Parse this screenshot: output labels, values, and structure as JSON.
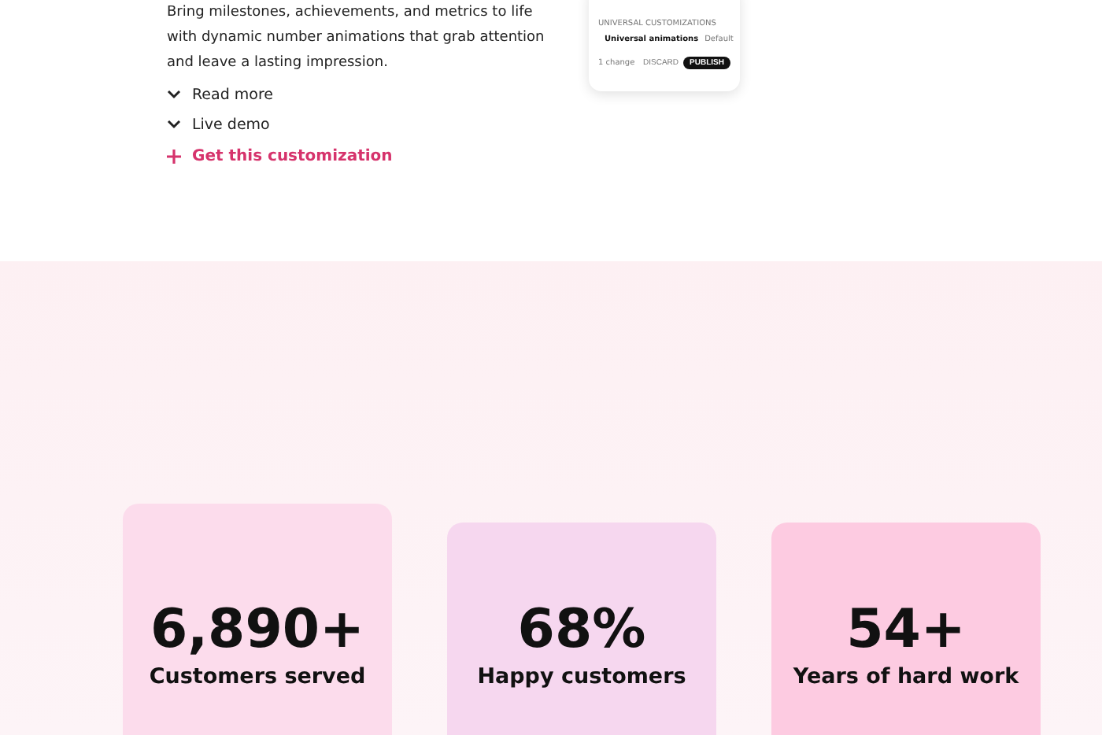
{
  "intro": {
    "description": "Bring milestones, achievements, and metrics to life with dynamic number animations that grab attention and leave a lasting impression.",
    "toggles": [
      {
        "label": "Read more",
        "expanded": false
      },
      {
        "label": "Live demo",
        "expanded": false
      }
    ],
    "cta": "Get this customization"
  },
  "preview": {
    "section_title": "UNIVERSAL CUSTOMIZATIONS",
    "setting": "Universal animations",
    "value": "Default",
    "changes": "1 change",
    "discard": "DISCARD",
    "publish": "PUBLISH"
  },
  "stats": [
    {
      "number": "6,890+",
      "label": "Customers served",
      "color": "#fcdcec"
    },
    {
      "number": "68%",
      "label": "Happy customers",
      "color": "#f6d7ef"
    },
    {
      "number": "54+",
      "label": "Years of hard work",
      "color": "#fdcbe1"
    }
  ]
}
